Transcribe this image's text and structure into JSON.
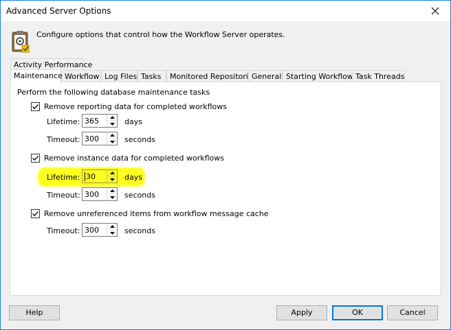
{
  "window": {
    "title": "Advanced Server Options"
  },
  "header": {
    "description": "Configure options that control how the Workflow Server operates."
  },
  "tabs": {
    "row1": [
      "Activity Performance"
    ],
    "row2": [
      "Maintenance",
      "Workflow",
      "Log Files",
      "Tasks",
      "Monitored Repositories",
      "General",
      "Starting Workflows",
      "Task Threads"
    ],
    "active": "Maintenance"
  },
  "maintenance": {
    "heading": "Perform the following database maintenance tasks",
    "reporting": {
      "label": "Remove reporting data for completed workflows",
      "checked": true,
      "lifetime_label": "Lifetime:",
      "lifetime_value": "365",
      "lifetime_unit": "days",
      "timeout_label": "Timeout:",
      "timeout_value": "300",
      "timeout_unit": "seconds"
    },
    "instance": {
      "label": "Remove instance data for completed workflows",
      "checked": true,
      "lifetime_label": "Lifetime:",
      "lifetime_value": "30",
      "lifetime_unit": "days",
      "timeout_label": "Timeout:",
      "timeout_value": "300",
      "timeout_unit": "seconds"
    },
    "cache": {
      "label": "Remove unreferenced items from workflow message cache",
      "checked": true,
      "timeout_label": "Timeout:",
      "timeout_value": "300",
      "timeout_unit": "seconds"
    }
  },
  "buttons": {
    "help": "Help",
    "apply": "Apply",
    "ok": "OK",
    "cancel": "Cancel"
  },
  "colors": {
    "highlight": "#ffff20",
    "accent": "#0078d7"
  }
}
